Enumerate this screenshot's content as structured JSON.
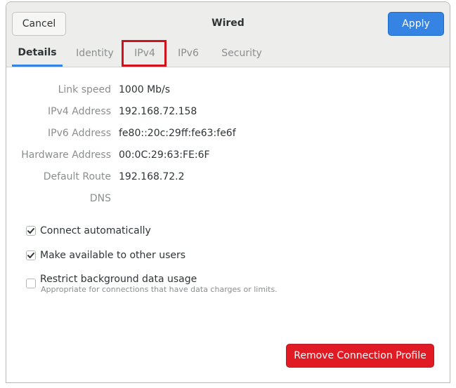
{
  "header": {
    "title": "Wired",
    "cancel_label": "Cancel",
    "apply_label": "Apply"
  },
  "tabs": [
    {
      "label": "Details",
      "active": true
    },
    {
      "label": "Identity",
      "active": false
    },
    {
      "label": "IPv4",
      "active": false
    },
    {
      "label": "IPv6",
      "active": false
    },
    {
      "label": "Security",
      "active": false
    }
  ],
  "details": [
    {
      "label": "Link speed",
      "value": "1000 Mb/s"
    },
    {
      "label": "IPv4 Address",
      "value": "192.168.72.158"
    },
    {
      "label": "IPv6 Address",
      "value": "fe80::20c:29ff:fe63:fe6f"
    },
    {
      "label": "Hardware Address",
      "value": "00:0C:29:63:FE:6F"
    },
    {
      "label": "Default Route",
      "value": "192.168.72.2"
    },
    {
      "label": "DNS",
      "value": ""
    }
  ],
  "options": {
    "connect_automatically": {
      "label": "Connect automatically",
      "checked": true
    },
    "available_to_others": {
      "label": "Make available to other users",
      "checked": true
    },
    "restrict_background": {
      "label": "Restrict background data usage",
      "sublabel": "Appropriate for connections that have data charges or limits.",
      "checked": false
    }
  },
  "remove_label": "Remove Connection Profile",
  "colors": {
    "accent": "#3584e4",
    "destructive": "#e01b24",
    "highlight": "#d0101b"
  }
}
